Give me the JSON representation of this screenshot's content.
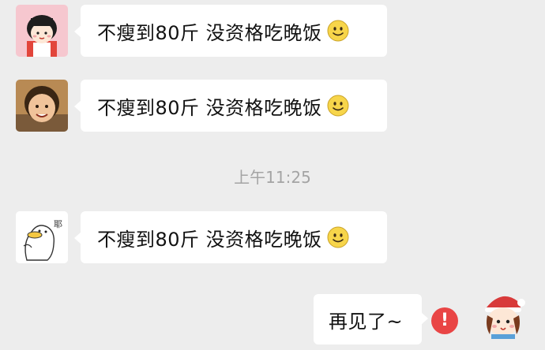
{
  "messages": [
    {
      "sender": "left",
      "text": "不瘦到80斤 没资格吃晚饭",
      "emoji": "smile-emoji"
    },
    {
      "sender": "left",
      "text": "不瘦到80斤 没资格吃晚饭",
      "emoji": "smile-emoji"
    },
    {
      "sender": "left",
      "text": "不瘦到80斤 没资格吃晚饭",
      "emoji": "smile-emoji"
    },
    {
      "sender": "self",
      "text": "再见了~",
      "status": "failed"
    }
  ],
  "timestamp": "上午11:25",
  "sticker_text": "耶",
  "colors": {
    "background": "#ededed",
    "bubble": "#ffffff",
    "timestamp": "#a4a4a4",
    "error": "#e94545"
  },
  "icons": {
    "error": "exclamation-icon",
    "emoji": "smile-emoji"
  }
}
